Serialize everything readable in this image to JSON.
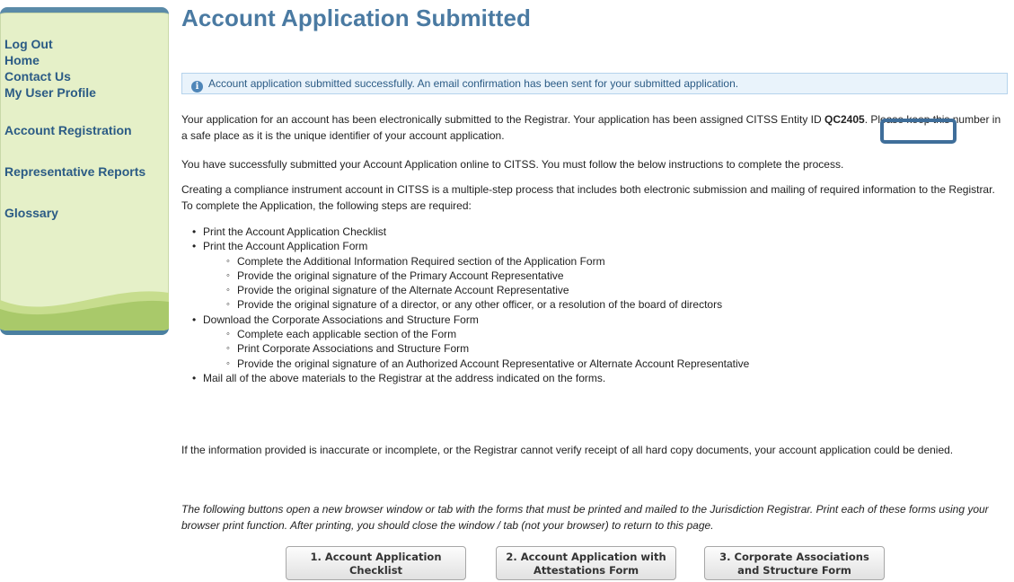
{
  "sidebar": {
    "items": [
      {
        "label": "Log Out"
      },
      {
        "label": "Home"
      },
      {
        "label": "Contact Us"
      },
      {
        "label": "My User Profile"
      },
      {
        "label": "Account Registration"
      },
      {
        "label": "Representative Reports"
      },
      {
        "label": "Glossary"
      }
    ]
  },
  "main": {
    "title": "Account Application Submitted",
    "alert": "Account application submitted successfully. An email confirmation has been sent for your submitted application.",
    "p1_before": "Your application for an account has been electronically submitted to the Registrar. Your application has been assigned CITSS Entity ID ",
    "entity_id": "QC2405",
    "p1_after": ". Please keep this number in a safe place as it is the unique identifier of your account application.",
    "p2": "You have successfully submitted your Account Application online to CITSS. You must follow the below instructions to complete the process.",
    "p3": "Creating a compliance instrument account in CITSS is a multiple-step process that includes both electronic submission and mailing of required information to the Registrar. To complete the Application, the following steps are required:",
    "steps": [
      {
        "text": "Print the Account Application Checklist",
        "sub": []
      },
      {
        "text": "Print the Account Application Form",
        "sub": [
          "Complete the Additional Information Required section of the Application Form",
          "Provide the original signature of the Primary Account Representative",
          "Provide the original signature of the Alternate Account Representative",
          "Provide the original signature of a director, or any other officer, or a resolution of the board of directors"
        ]
      },
      {
        "text": "Download the Corporate Associations and Structure Form",
        "sub": [
          "Complete each applicable section of the Form",
          "Print Corporate Associations and Structure Form",
          "Provide the original signature of an Authorized Account Representative or Alternate Account Representative"
        ]
      },
      {
        "text": "Mail all of the above materials to the Registrar at the address indicated on the forms.",
        "sub": []
      }
    ],
    "p4": "If the information provided is inaccurate or incomplete, or the Registrar cannot verify receipt of all hard copy documents, your account application could be denied.",
    "p5": "The following buttons open a new browser window or tab with the forms that must be printed and mailed to the Jurisdiction Registrar. Print each of these forms using your browser print function. After printing, you should close the window / tab (not your browser) to return to this page.",
    "buttons": [
      {
        "line1": "1. Account Application",
        "line2": "Checklist"
      },
      {
        "line1": "2. Account Application with",
        "line2": "Attestations Form"
      },
      {
        "line1": "3. Corporate Associations",
        "line2": "and Structure Form"
      }
    ]
  },
  "colors": {
    "sidebar_bg": "#e5f0c8",
    "link": "#2b5b85",
    "title": "#4a7aa2",
    "highlight_border": "#3f6e9a"
  }
}
